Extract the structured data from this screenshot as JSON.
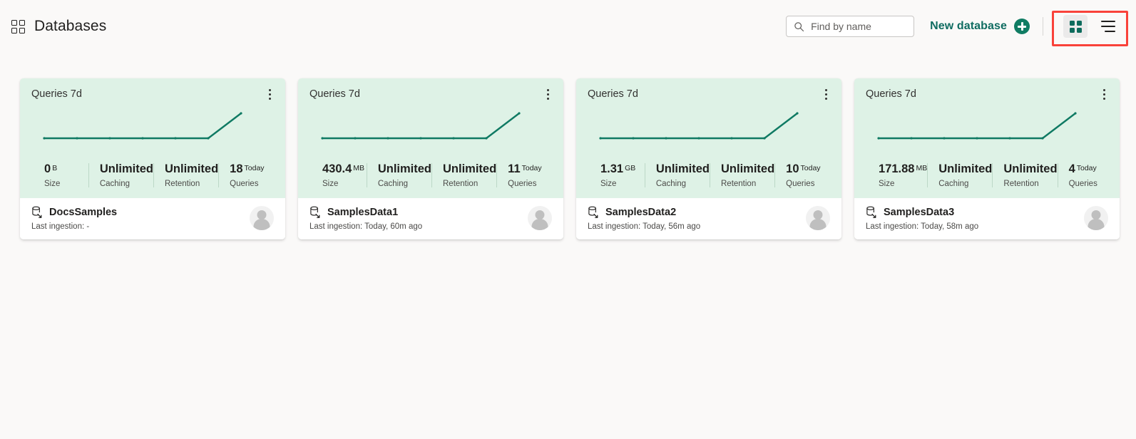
{
  "header": {
    "apps_icon": "grid-apps-icon",
    "title": "Databases",
    "search": {
      "icon": "search-icon",
      "placeholder": "Find by name",
      "value": ""
    },
    "new_database": {
      "label": "New database",
      "icon": "plus-circle-icon"
    },
    "view_toggle": {
      "grid_icon": "grid-view-icon",
      "list_icon": "list-view-icon",
      "active": "grid",
      "highlight_color": "#f9423a"
    }
  },
  "colors": {
    "accent": "#107c63",
    "link": "#0f6c61",
    "card_top_bg": "#def2e6",
    "spark_line": "#0f7a63",
    "page_bg": "#faf9f8"
  },
  "cards": [
    {
      "chart_title": "Queries 7d",
      "kebab_icon": "more-vertical-icon",
      "metrics": [
        {
          "value": "0",
          "unit": "B",
          "label": "Size"
        },
        {
          "value": "Unlimited",
          "unit": "",
          "label": "Caching"
        },
        {
          "value": "Unlimited",
          "unit": "",
          "label": "Retention"
        },
        {
          "value": "18",
          "unit": "Today",
          "label": "Queries"
        }
      ],
      "db_icon": "database-icon",
      "db_name": "DocsSamples",
      "last_ingestion": "Last ingestion: -",
      "avatar_icon": "user-avatar-icon"
    },
    {
      "chart_title": "Queries 7d",
      "kebab_icon": "more-vertical-icon",
      "metrics": [
        {
          "value": "430.4",
          "unit": "MB",
          "label": "Size"
        },
        {
          "value": "Unlimited",
          "unit": "",
          "label": "Caching"
        },
        {
          "value": "Unlimited",
          "unit": "",
          "label": "Retention"
        },
        {
          "value": "11",
          "unit": "Today",
          "label": "Queries"
        }
      ],
      "db_icon": "database-icon",
      "db_name": "SamplesData1",
      "last_ingestion": "Last ingestion: Today, 60m ago",
      "avatar_icon": "user-avatar-icon"
    },
    {
      "chart_title": "Queries 7d",
      "kebab_icon": "more-vertical-icon",
      "metrics": [
        {
          "value": "1.31",
          "unit": "GB",
          "label": "Size"
        },
        {
          "value": "Unlimited",
          "unit": "",
          "label": "Caching"
        },
        {
          "value": "Unlimited",
          "unit": "",
          "label": "Retention"
        },
        {
          "value": "10",
          "unit": "Today",
          "label": "Queries"
        }
      ],
      "db_icon": "database-icon",
      "db_name": "SamplesData2",
      "last_ingestion": "Last ingestion: Today, 56m ago",
      "avatar_icon": "user-avatar-icon"
    },
    {
      "chart_title": "Queries 7d",
      "kebab_icon": "more-vertical-icon",
      "metrics": [
        {
          "value": "171.88",
          "unit": "MB",
          "label": "Size"
        },
        {
          "value": "Unlimited",
          "unit": "",
          "label": "Caching"
        },
        {
          "value": "Unlimited",
          "unit": "",
          "label": "Retention"
        },
        {
          "value": "4",
          "unit": "Today",
          "label": "Queries"
        }
      ],
      "db_icon": "database-icon",
      "db_name": "SamplesData3",
      "last_ingestion": "Last ingestion: Today, 58m ago",
      "avatar_icon": "user-avatar-icon"
    }
  ],
  "chart_data": [
    {
      "type": "line",
      "title": "Queries 7d",
      "x": [
        1,
        2,
        3,
        4,
        5,
        6,
        7
      ],
      "values": [
        0,
        0,
        0,
        0,
        0,
        0,
        18
      ],
      "xlabel": "",
      "ylabel": "",
      "grid": false,
      "legend": "none",
      "ylim": [
        0,
        18
      ]
    },
    {
      "type": "line",
      "title": "Queries 7d",
      "x": [
        1,
        2,
        3,
        4,
        5,
        6,
        7
      ],
      "values": [
        0,
        0,
        0,
        0,
        0,
        0,
        11
      ],
      "xlabel": "",
      "ylabel": "",
      "grid": false,
      "legend": "none",
      "ylim": [
        0,
        11
      ]
    },
    {
      "type": "line",
      "title": "Queries 7d",
      "x": [
        1,
        2,
        3,
        4,
        5,
        6,
        7
      ],
      "values": [
        0,
        0,
        0,
        0,
        0,
        0,
        10
      ],
      "xlabel": "",
      "ylabel": "",
      "grid": false,
      "legend": "none",
      "ylim": [
        0,
        10
      ]
    },
    {
      "type": "line",
      "title": "Queries 7d",
      "x": [
        1,
        2,
        3,
        4,
        5,
        6,
        7
      ],
      "values": [
        0,
        0,
        0,
        0,
        0,
        0,
        4
      ],
      "xlabel": "",
      "ylabel": "",
      "grid": false,
      "legend": "none",
      "ylim": [
        0,
        4
      ]
    }
  ]
}
